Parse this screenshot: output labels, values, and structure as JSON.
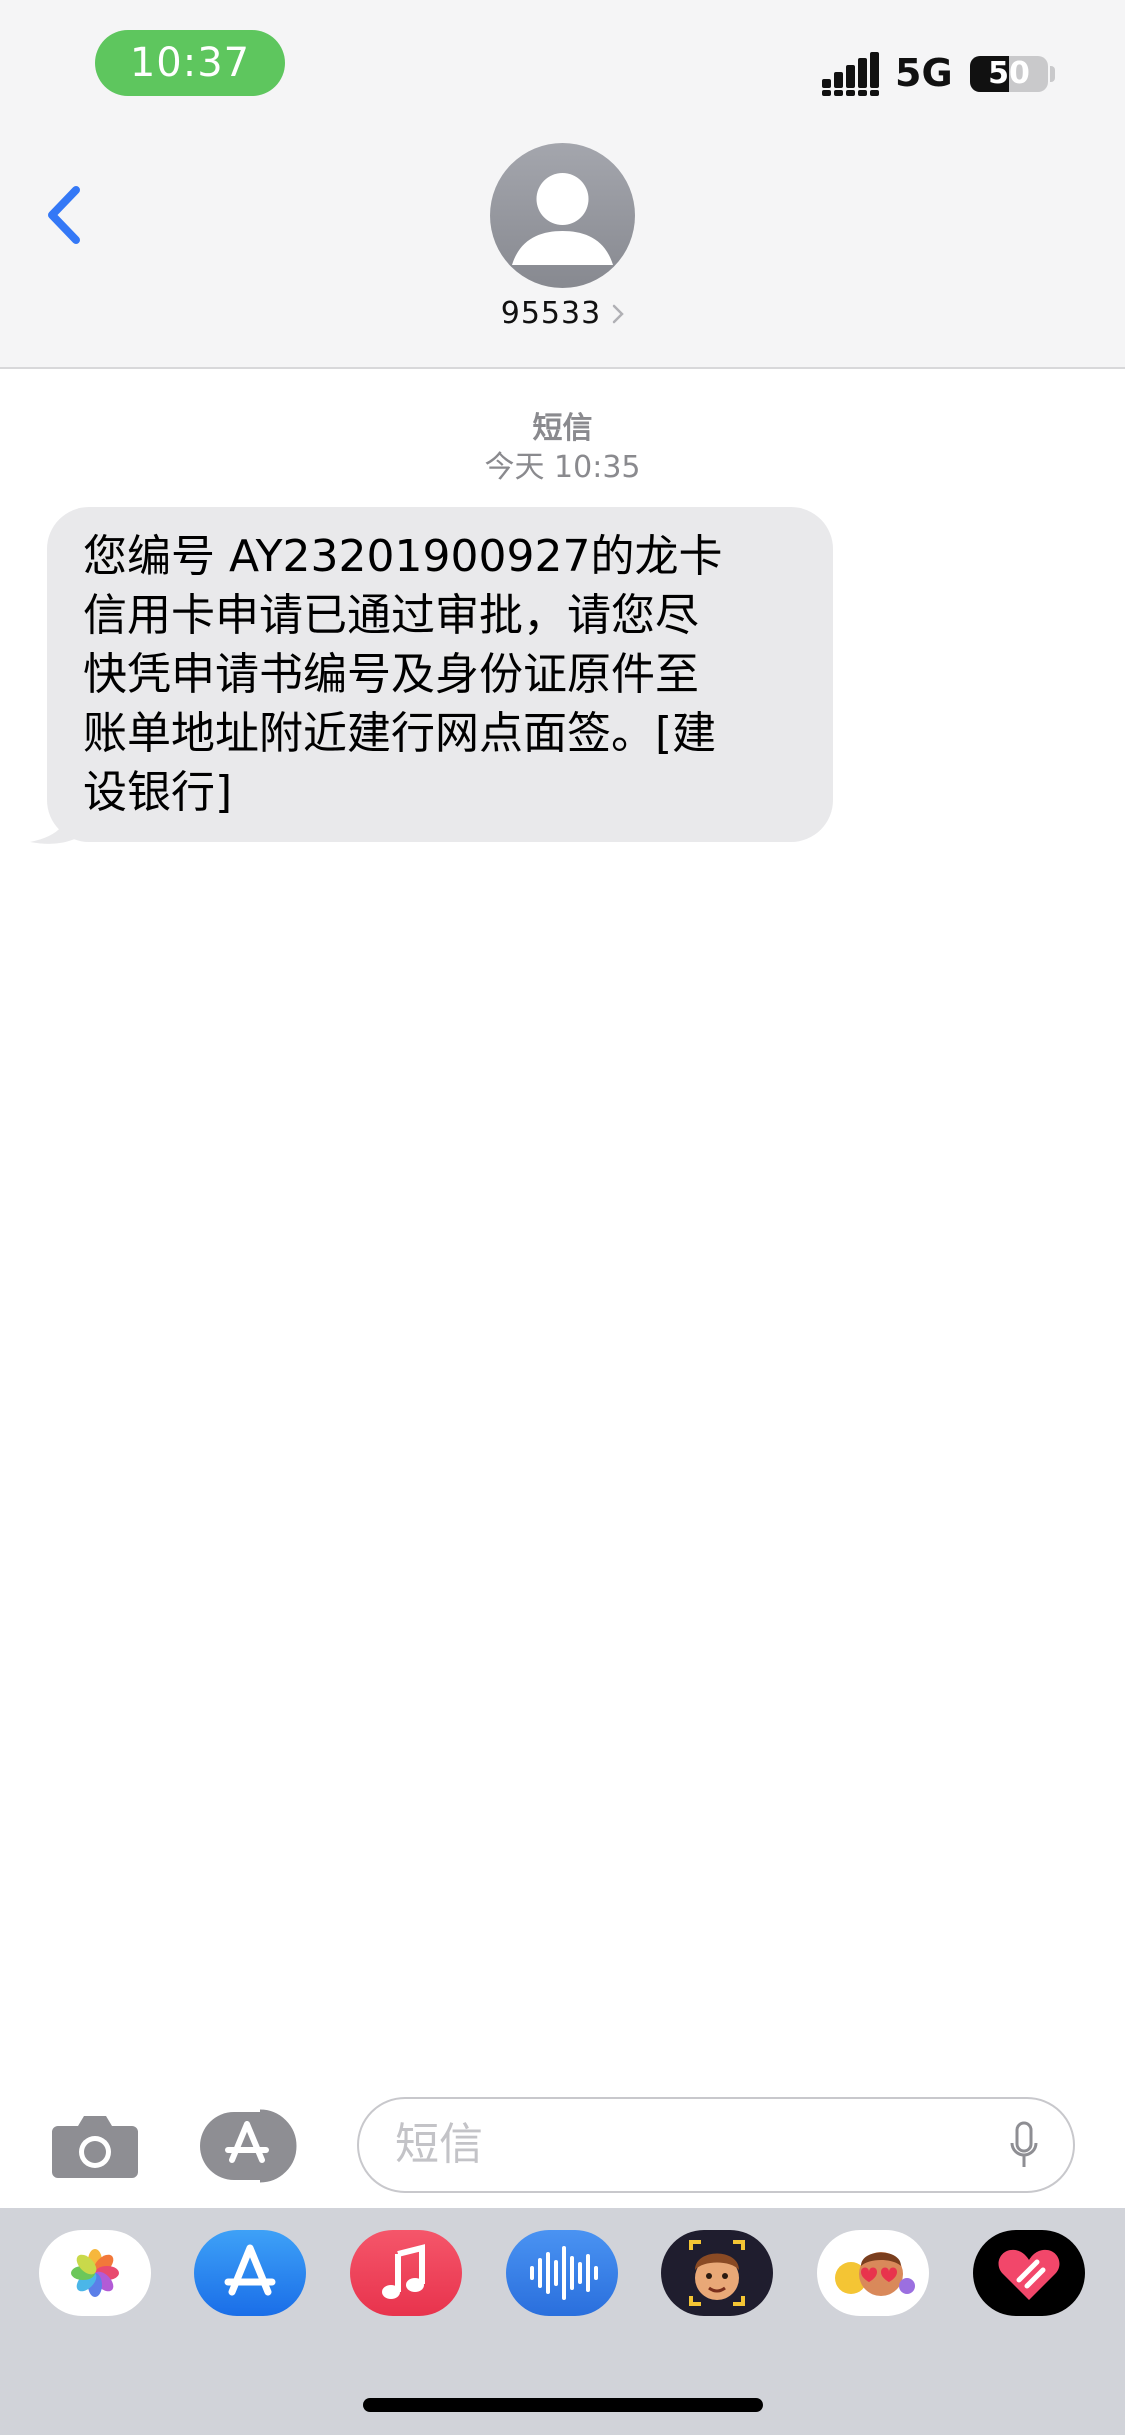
{
  "status_bar": {
    "time": "10:37",
    "network": "5G",
    "battery": "50",
    "battery_level": 0.5
  },
  "header": {
    "contact": "95533"
  },
  "conversation": {
    "service_label": "短信",
    "timestamp": "今天 10:35",
    "messages": [
      {
        "direction": "incoming",
        "text": "您编号 AY23201900927的龙卡\n信用卡申请已通过审批，请您尽\n快凭申请书编号及身份证原件至\n账单地址附近建行网点面签。[建\n设银行]"
      }
    ]
  },
  "composer": {
    "placeholder": "短信"
  },
  "app_drawer": {
    "apps": [
      "photos-app",
      "app-store-app",
      "music-app",
      "audio-message-app",
      "memoji-app",
      "animoji-stickers-app",
      "digital-touch-app"
    ]
  },
  "colors": {
    "accent": "#3478f6",
    "time_pill": "#5ec65e",
    "bubble": "#e9e9eb",
    "drawer": "#d1d3d9"
  }
}
